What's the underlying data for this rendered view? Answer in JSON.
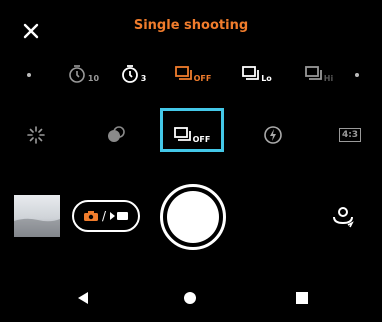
{
  "header": {
    "title": "Single shooting"
  },
  "drive_modes": {
    "items": [
      {
        "icon": "self-timer-10s-icon",
        "sub": "10"
      },
      {
        "icon": "self-timer-3s-icon",
        "sub": "3"
      },
      {
        "icon": "continuous-shooting-off-icon",
        "sub": "OFF"
      },
      {
        "icon": "continuous-shooting-lo-icon",
        "sub": "Lo"
      },
      {
        "icon": "continuous-shooting-hi-icon",
        "sub": "Hi"
      }
    ],
    "selected": "continuous-shooting-off-icon"
  },
  "settings": {
    "items": [
      {
        "icon": "flash-off-icon"
      },
      {
        "icon": "bokeh-icon"
      },
      {
        "icon": "drive-mode-icon",
        "sub": "OFF"
      },
      {
        "icon": "flash-icon"
      },
      {
        "icon": "aspect-ratio-icon",
        "label": "4:3"
      }
    ],
    "selected": "drive-mode-icon"
  },
  "capture": {
    "mode_separator": "/"
  },
  "nav": {
    "icons": [
      "back-icon",
      "home-icon",
      "recents-icon"
    ]
  },
  "colors": {
    "accent": "#f07c2c",
    "selection": "#44c8e8",
    "dim": "#9a9a9a"
  }
}
